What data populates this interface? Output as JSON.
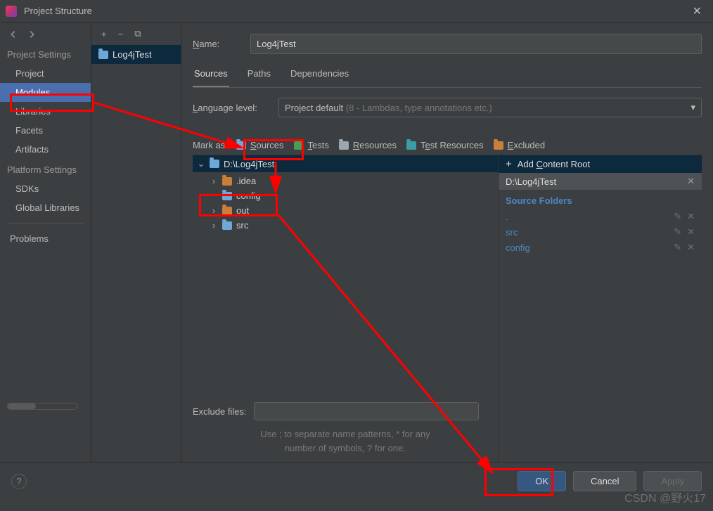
{
  "window": {
    "title": "Project Structure"
  },
  "sidebar": {
    "sections": [
      {
        "title": "Project Settings",
        "items": [
          "Project",
          "Modules",
          "Libraries",
          "Facets",
          "Artifacts"
        ],
        "selected": 1
      },
      {
        "title": "Platform Settings",
        "items": [
          "SDKs",
          "Global Libraries"
        ]
      }
    ],
    "problems": "Problems"
  },
  "modules": {
    "selected": "Log4jTest"
  },
  "form": {
    "name_label": "Name:",
    "name_value": "Log4jTest",
    "tabs": [
      "Sources",
      "Paths",
      "Dependencies"
    ],
    "active_tab": 0,
    "lang_label": "Language level:",
    "lang_value": "Project default",
    "lang_hint": "(8 - Lambdas, type annotations etc.)"
  },
  "mark": {
    "label": "Mark as:",
    "options": [
      "Sources",
      "Tests",
      "Resources",
      "Test Resources",
      "Excluded"
    ]
  },
  "tree": {
    "root": "D:\\Log4jTest",
    "children": [
      {
        "name": ".idea",
        "color": "orange",
        "expandable": true
      },
      {
        "name": "config",
        "color": "blue",
        "expandable": false
      },
      {
        "name": "out",
        "color": "orange",
        "expandable": true
      },
      {
        "name": "src",
        "color": "blue",
        "expandable": true
      }
    ]
  },
  "right": {
    "add": "Add Content Root",
    "root": "D:\\Log4jTest",
    "section": "Source Folders",
    "items": [
      ".",
      "src",
      "config"
    ]
  },
  "exclude": {
    "label": "Exclude files:",
    "hint1": "Use ; to separate name patterns, * for any",
    "hint2": "number of symbols, ? for one."
  },
  "footer": {
    "ok": "OK",
    "cancel": "Cancel",
    "apply": "Apply"
  },
  "watermark": "CSDN @野火17"
}
